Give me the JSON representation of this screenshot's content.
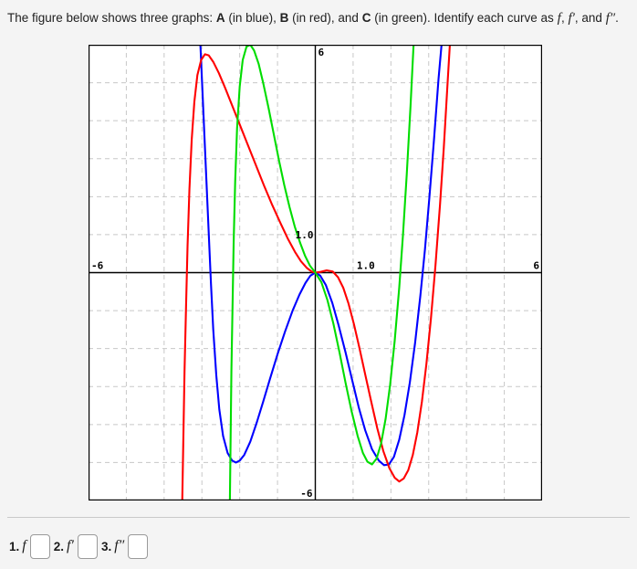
{
  "prompt": {
    "part1": "The figure below shows three graphs: ",
    "label_a": "A",
    "part2": " (in blue), ",
    "label_b": "B",
    "part3": " (in red), and ",
    "label_c": "C",
    "part4": " (in green). Identify each curve as ",
    "sym_f": "f",
    "sep1": ", ",
    "sym_fp": "f′",
    "sep2": ", and ",
    "sym_fpp": "f″",
    "period": "."
  },
  "answers": {
    "items": [
      {
        "num": "1.",
        "symbol": "f",
        "value": "",
        "placeholder": ""
      },
      {
        "num": "2.",
        "symbol": "f′",
        "value": "",
        "placeholder": ""
      },
      {
        "num": "3.",
        "symbol": "f″",
        "value": "",
        "placeholder": ""
      }
    ]
  },
  "chart_data": {
    "type": "line",
    "title": "",
    "xlabel": "",
    "ylabel": "",
    "xlim": [
      -6,
      6
    ],
    "ylim": [
      -6,
      6
    ],
    "grid": true,
    "grid_color": "#c8c8c8",
    "grid_style": "dashed",
    "axis_color": "#000000",
    "frame_color": "#000000",
    "background": "#ffffff",
    "legend": "none",
    "tick_labels": {
      "x_left": "-6",
      "x_right": "6",
      "x_unit": "1.0",
      "y_top": "6",
      "y_bottom": "-6",
      "y_unit": "1.0"
    },
    "series": [
      {
        "name": "A",
        "color": "#0000ff",
        "label": "blue",
        "points": [
          [
            -3.04,
            6.0
          ],
          [
            -3.0,
            5.1
          ],
          [
            -2.96,
            4.2
          ],
          [
            -2.92,
            3.3
          ],
          [
            -2.88,
            2.4
          ],
          [
            -2.84,
            1.5
          ],
          [
            -2.8,
            0.6
          ],
          [
            -2.76,
            -0.3
          ],
          [
            -2.7,
            -1.5
          ],
          [
            -2.62,
            -2.7
          ],
          [
            -2.54,
            -3.6
          ],
          [
            -2.44,
            -4.3
          ],
          [
            -2.32,
            -4.75
          ],
          [
            -2.2,
            -4.95
          ],
          [
            -2.1,
            -5.0
          ],
          [
            -2.0,
            -4.95
          ],
          [
            -1.88,
            -4.8
          ],
          [
            -1.72,
            -4.45
          ],
          [
            -1.55,
            -3.95
          ],
          [
            -1.38,
            -3.4
          ],
          [
            -1.2,
            -2.8
          ],
          [
            -1.0,
            -2.15
          ],
          [
            -0.8,
            -1.55
          ],
          [
            -0.6,
            -1.0
          ],
          [
            -0.42,
            -0.58
          ],
          [
            -0.26,
            -0.27
          ],
          [
            -0.13,
            -0.08
          ],
          [
            0.0,
            0.0
          ],
          [
            0.13,
            -0.08
          ],
          [
            0.28,
            -0.33
          ],
          [
            0.45,
            -0.8
          ],
          [
            0.62,
            -1.4
          ],
          [
            0.8,
            -2.1
          ],
          [
            0.98,
            -2.85
          ],
          [
            1.15,
            -3.55
          ],
          [
            1.32,
            -4.15
          ],
          [
            1.5,
            -4.65
          ],
          [
            1.68,
            -4.95
          ],
          [
            1.82,
            -5.07
          ],
          [
            1.95,
            -5.05
          ],
          [
            2.08,
            -4.85
          ],
          [
            2.22,
            -4.4
          ],
          [
            2.36,
            -3.75
          ],
          [
            2.5,
            -2.9
          ],
          [
            2.64,
            -1.85
          ],
          [
            2.78,
            -0.6
          ],
          [
            2.9,
            0.6
          ],
          [
            3.02,
            2.0
          ],
          [
            3.14,
            3.5
          ],
          [
            3.26,
            5.1
          ],
          [
            3.34,
            6.0
          ]
        ]
      },
      {
        "name": "B",
        "color": "#ff0000",
        "label": "red",
        "points": [
          [
            -3.52,
            -6.0
          ],
          [
            -3.49,
            -4.3
          ],
          [
            -3.46,
            -2.6
          ],
          [
            -3.42,
            -0.9
          ],
          [
            -3.38,
            0.7
          ],
          [
            -3.33,
            2.2
          ],
          [
            -3.27,
            3.5
          ],
          [
            -3.2,
            4.5
          ],
          [
            -3.12,
            5.2
          ],
          [
            -3.02,
            5.6
          ],
          [
            -2.92,
            5.75
          ],
          [
            -2.82,
            5.72
          ],
          [
            -2.7,
            5.55
          ],
          [
            -2.55,
            5.25
          ],
          [
            -2.38,
            4.85
          ],
          [
            -2.2,
            4.4
          ],
          [
            -2.0,
            3.9
          ],
          [
            -1.8,
            3.4
          ],
          [
            -1.58,
            2.85
          ],
          [
            -1.36,
            2.3
          ],
          [
            -1.14,
            1.78
          ],
          [
            -0.92,
            1.3
          ],
          [
            -0.72,
            0.88
          ],
          [
            -0.54,
            0.55
          ],
          [
            -0.38,
            0.3
          ],
          [
            -0.22,
            0.12
          ],
          [
            -0.1,
            0.03
          ],
          [
            0.0,
            0.0
          ],
          [
            0.14,
            0.02
          ],
          [
            0.3,
            0.06
          ],
          [
            0.46,
            0.03
          ],
          [
            0.6,
            -0.12
          ],
          [
            0.74,
            -0.4
          ],
          [
            0.88,
            -0.82
          ],
          [
            1.02,
            -1.35
          ],
          [
            1.16,
            -1.95
          ],
          [
            1.32,
            -2.68
          ],
          [
            1.48,
            -3.4
          ],
          [
            1.64,
            -4.1
          ],
          [
            1.8,
            -4.7
          ],
          [
            1.96,
            -5.15
          ],
          [
            2.1,
            -5.4
          ],
          [
            2.22,
            -5.5
          ],
          [
            2.34,
            -5.42
          ],
          [
            2.46,
            -5.2
          ],
          [
            2.58,
            -4.8
          ],
          [
            2.7,
            -4.2
          ],
          [
            2.82,
            -3.4
          ],
          [
            2.94,
            -2.4
          ],
          [
            3.06,
            -1.2
          ],
          [
            3.18,
            0.2
          ],
          [
            3.3,
            1.8
          ],
          [
            3.4,
            3.3
          ],
          [
            3.5,
            5.0
          ],
          [
            3.56,
            6.0
          ]
        ]
      },
      {
        "name": "C",
        "color": "#00dd00",
        "label": "green",
        "points": [
          [
            -2.26,
            -6.0
          ],
          [
            -2.24,
            -4.3
          ],
          [
            -2.22,
            -2.6
          ],
          [
            -2.19,
            -0.9
          ],
          [
            -2.16,
            0.8
          ],
          [
            -2.12,
            2.4
          ],
          [
            -2.07,
            3.8
          ],
          [
            -2.0,
            4.9
          ],
          [
            -1.92,
            5.6
          ],
          [
            -1.82,
            5.95
          ],
          [
            -1.72,
            6.0
          ],
          [
            -1.62,
            5.85
          ],
          [
            -1.5,
            5.5
          ],
          [
            -1.38,
            5.0
          ],
          [
            -1.24,
            4.35
          ],
          [
            -1.1,
            3.65
          ],
          [
            -0.96,
            2.95
          ],
          [
            -0.82,
            2.3
          ],
          [
            -0.68,
            1.72
          ],
          [
            -0.54,
            1.2
          ],
          [
            -0.4,
            0.78
          ],
          [
            -0.27,
            0.44
          ],
          [
            -0.14,
            0.18
          ],
          [
            0.0,
            0.0
          ],
          [
            0.16,
            -0.25
          ],
          [
            0.32,
            -0.72
          ],
          [
            0.48,
            -1.35
          ],
          [
            0.64,
            -2.1
          ],
          [
            0.8,
            -2.9
          ],
          [
            0.96,
            -3.65
          ],
          [
            1.12,
            -4.3
          ],
          [
            1.26,
            -4.75
          ],
          [
            1.38,
            -4.98
          ],
          [
            1.5,
            -5.05
          ],
          [
            1.62,
            -4.9
          ],
          [
            1.74,
            -4.5
          ],
          [
            1.86,
            -3.85
          ],
          [
            1.98,
            -2.95
          ],
          [
            2.1,
            -1.8
          ],
          [
            2.22,
            -0.4
          ],
          [
            2.32,
            1.0
          ],
          [
            2.42,
            2.6
          ],
          [
            2.52,
            4.4
          ],
          [
            2.6,
            6.0
          ]
        ]
      }
    ]
  }
}
